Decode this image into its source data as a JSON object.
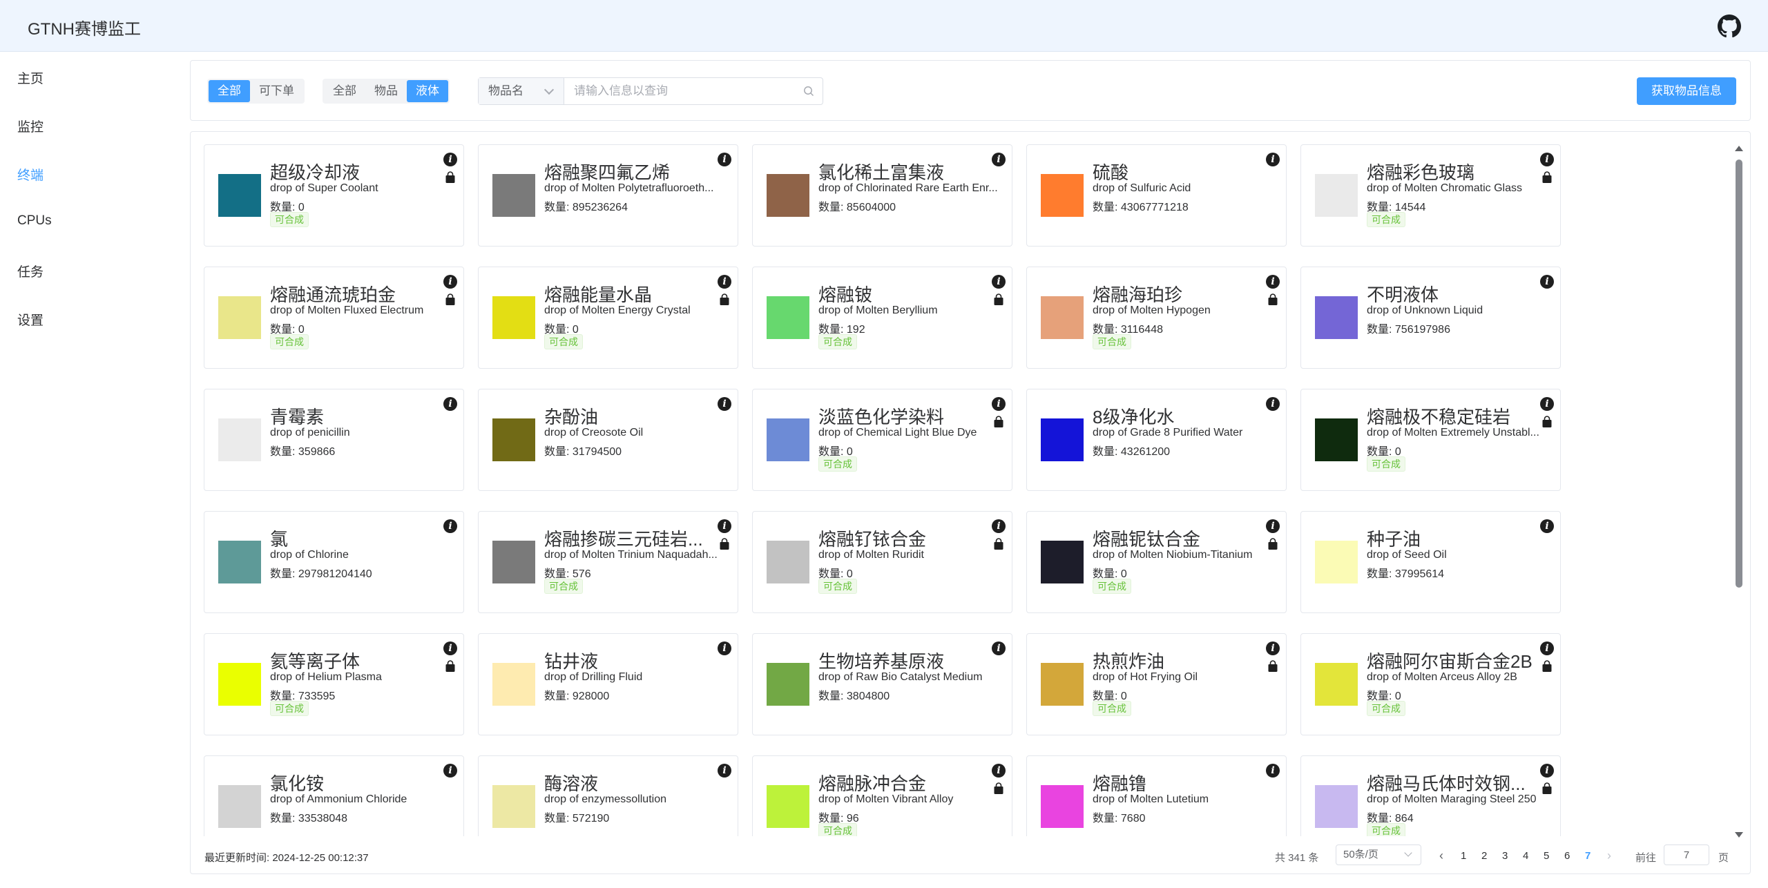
{
  "app": {
    "title": "GTNH赛博监工"
  },
  "header": {
    "github_icon": "github-icon"
  },
  "sidebar": {
    "items": [
      {
        "label": "主页"
      },
      {
        "label": "监控"
      },
      {
        "label": "终端",
        "active": true
      },
      {
        "label": "CPUs"
      },
      {
        "label": "任务"
      },
      {
        "label": "设置"
      }
    ]
  },
  "toolbar": {
    "craft_filter": [
      {
        "label": "全部",
        "active": true
      },
      {
        "label": "可下单"
      }
    ],
    "type_filter": [
      {
        "label": "全部"
      },
      {
        "label": "物品"
      },
      {
        "label": "液体",
        "active": true
      }
    ],
    "search_field": "物品名",
    "search_placeholder": "请输入信息以查询",
    "fetch_button": "获取物品信息"
  },
  "colors": {
    "accent": "#409eff",
    "craftable_tag": "#67c23a"
  },
  "items": [
    {
      "name": "超级冷却液",
      "eng": "drop of Super Coolant",
      "qty": "数量: 0",
      "craftable": true,
      "color": "#136f86"
    },
    {
      "name": "熔融聚四氟乙烯",
      "eng": "drop of Molten Polytetrafluoroeth...",
      "qty": "数量: 895236264",
      "craftable": false,
      "color": "#7a7a7a"
    },
    {
      "name": "氯化稀土富集液",
      "eng": "drop of Chlorinated Rare Earth Enr...",
      "qty": "数量: 85604000",
      "craftable": false,
      "color": "#8f6348"
    },
    {
      "name": "硫酸",
      "eng": "drop of Sulfuric Acid",
      "qty": "数量: 43067771218",
      "craftable": false,
      "color": "#ff7c2e"
    },
    {
      "name": "熔融彩色玻璃",
      "eng": "drop of Molten Chromatic Glass",
      "qty": "数量: 14544",
      "craftable": true,
      "color": "#eaeaea"
    },
    {
      "name": "熔融通流琥珀金",
      "eng": "drop of Molten Fluxed Electrum",
      "qty": "数量: 0",
      "craftable": true,
      "color": "#e9e68a"
    },
    {
      "name": "熔融能量水晶",
      "eng": "drop of Molten Energy Crystal",
      "qty": "数量: 0",
      "craftable": true,
      "color": "#e3de14"
    },
    {
      "name": "熔融铍",
      "eng": "drop of Molten Beryllium",
      "qty": "数量: 192",
      "craftable": true,
      "color": "#67d86e"
    },
    {
      "name": "熔融海珀珍",
      "eng": "drop of Molten Hypogen",
      "qty": "数量: 3116448",
      "craftable": true,
      "color": "#e6a17a"
    },
    {
      "name": "不明液体",
      "eng": "drop of Unknown Liquid",
      "qty": "数量: 756197986",
      "craftable": false,
      "color": "#7466d6"
    },
    {
      "name": "青霉素",
      "eng": "drop of penicillin",
      "qty": "数量: 359866",
      "craftable": false,
      "color": "#ebebeb"
    },
    {
      "name": "杂酚油",
      "eng": "drop of Creosote Oil",
      "qty": "数量: 31794500",
      "craftable": false,
      "color": "#716a16"
    },
    {
      "name": "淡蓝色化学染料",
      "eng": "drop of Chemical Light Blue Dye",
      "qty": "数量: 0",
      "craftable": true,
      "color": "#6d8bd6"
    },
    {
      "name": "8级净化水",
      "eng": "drop of Grade 8 Purified Water",
      "qty": "数量: 43261200",
      "craftable": false,
      "color": "#1414d8"
    },
    {
      "name": "熔融极不稳定硅岩",
      "eng": "drop of Molten Extremely Unstabl...",
      "qty": "数量: 0",
      "craftable": true,
      "color": "#0f2b0e"
    },
    {
      "name": "氯",
      "eng": "drop of Chlorine",
      "qty": "数量: 297981204140",
      "craftable": false,
      "color": "#5e9a98"
    },
    {
      "name": "熔融掺碳三元硅岩...",
      "eng": "drop of Molten Trinium Naquadah...",
      "qty": "数量: 576",
      "craftable": true,
      "color": "#7a7a7a"
    },
    {
      "name": "熔融钌铱合金",
      "eng": "drop of Molten Ruridit",
      "qty": "数量: 0",
      "craftable": true,
      "color": "#c2c2c2"
    },
    {
      "name": "熔融铌钛合金",
      "eng": "drop of Molten Niobium-Titanium",
      "qty": "数量: 0",
      "craftable": true,
      "color": "#1d1d2a"
    },
    {
      "name": "种子油",
      "eng": "drop of Seed Oil",
      "qty": "数量: 37995614",
      "craftable": false,
      "color": "#fbfbb5"
    },
    {
      "name": "氦等离子体",
      "eng": "drop of Helium Plasma",
      "qty": "数量: 733595",
      "craftable": true,
      "color": "#eaff00"
    },
    {
      "name": "钻井液",
      "eng": "drop of Drilling Fluid",
      "qty": "数量: 928000",
      "craftable": false,
      "color": "#feebb0"
    },
    {
      "name": "生物培养基原液",
      "eng": "drop of Raw Bio Catalyst Medium",
      "qty": "数量: 3804800",
      "craftable": false,
      "color": "#72a845"
    },
    {
      "name": "热煎炸油",
      "eng": "drop of Hot Frying Oil",
      "qty": "数量: 0",
      "craftable": true,
      "color": "#d3a73a"
    },
    {
      "name": "熔融阿尔宙斯合金2B",
      "eng": "drop of Molten Arceus Alloy 2B",
      "qty": "数量: 0",
      "craftable": true,
      "color": "#e3e53a"
    },
    {
      "name": "氯化铵",
      "eng": "drop of Ammonium Chloride",
      "qty": "数量: 33538048",
      "craftable": false,
      "color": "#d3d3d3"
    },
    {
      "name": "酶溶液",
      "eng": "drop of enzymessollution",
      "qty": "数量: 572190",
      "craftable": false,
      "color": "#ede8a4"
    },
    {
      "name": "熔融脉冲合金",
      "eng": "drop of Molten Vibrant Alloy",
      "qty": "数量: 96",
      "craftable": true,
      "color": "#bdf23a"
    },
    {
      "name": "熔融镥",
      "eng": "drop of Molten Lutetium",
      "qty": "数量: 7680",
      "craftable": false,
      "color": "#e944e0"
    },
    {
      "name": "熔融马氏体时效钢...",
      "eng": "drop of Molten Maraging Steel 250",
      "qty": "数量: 864",
      "craftable": true,
      "color": "#c8b9f0"
    }
  ],
  "craftable_label": "可合成",
  "footer": {
    "updated": "最近更新时间: 2024-12-25 00:12:37",
    "total": "共 341 条",
    "page_size": "50条/页",
    "pages": [
      "1",
      "2",
      "3",
      "4",
      "5",
      "6",
      "7"
    ],
    "current_page": "7",
    "goto_label": "前往",
    "goto_value": "7",
    "page_suffix": "页"
  }
}
